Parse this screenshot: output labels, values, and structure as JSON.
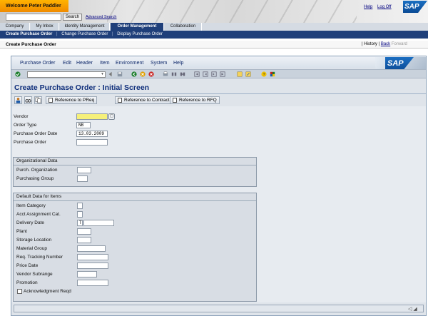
{
  "portal": {
    "welcome": "Welcome Peter Paddler",
    "search_button": "Search",
    "advanced_search": "Advanced Search",
    "help": "Help",
    "logoff": "Log Off",
    "logo": "SAP"
  },
  "tabs": [
    {
      "label": "Company"
    },
    {
      "label": "My Inbox"
    },
    {
      "label": "Identity Management"
    },
    {
      "label": "Order Management"
    },
    {
      "label": "Collaboration"
    }
  ],
  "subnav": {
    "items": [
      {
        "label": "Create Purchase Order"
      },
      {
        "label": "Change Purchase Order"
      },
      {
        "label": "Display Purchase Order"
      }
    ],
    "separator": "|"
  },
  "pagebar": {
    "title": "Create Purchase Order",
    "history": "History",
    "back": "Back",
    "forward": "Forward",
    "sep": "|"
  },
  "menu": [
    "Purchase Order",
    "Edit",
    "Header",
    "Item",
    "Environment",
    "System",
    "Help"
  ],
  "screen": {
    "title": "Create Purchase Order : Initial Screen"
  },
  "app_toolbar": {
    "ref_preq": "Reference to PReq",
    "ref_contract": "Reference to Contract",
    "ref_rfq": "Reference to RFQ"
  },
  "form": {
    "vendor_label": "Vendor",
    "vendor_value": "",
    "order_type_label": "Order Type",
    "order_type_value": "NB",
    "po_date_label": "Purchase Order Date",
    "po_date_value": "13.03.2009",
    "po_label": "Purchase Order",
    "po_value": ""
  },
  "org_group": {
    "title": "Organizational Data",
    "purch_org": "Purch. Organization",
    "purch_group": "Purchasing Group"
  },
  "default_group": {
    "title": "Default Data for Items",
    "item_category": "Item Category",
    "acct_assignment": "Acct Assignment Cat.",
    "delivery_date": "Delivery Date",
    "delivery_date_type": "T",
    "plant": "Plant",
    "storage_location": "Storage Location",
    "material_group": "Material Group",
    "req_tracking": "Req. Tracking Number",
    "price_date": "Price Date",
    "vendor_subrange": "Vendor Subrange",
    "promotion": "Promotion",
    "ack_reqd": "Acknowledgment Reqd"
  },
  "colors": {
    "accent_orange": "#f08a00",
    "nav_blue": "#1f3f7a",
    "title_blue": "#0d2d7a",
    "required_yellow": "#f6f07a"
  }
}
